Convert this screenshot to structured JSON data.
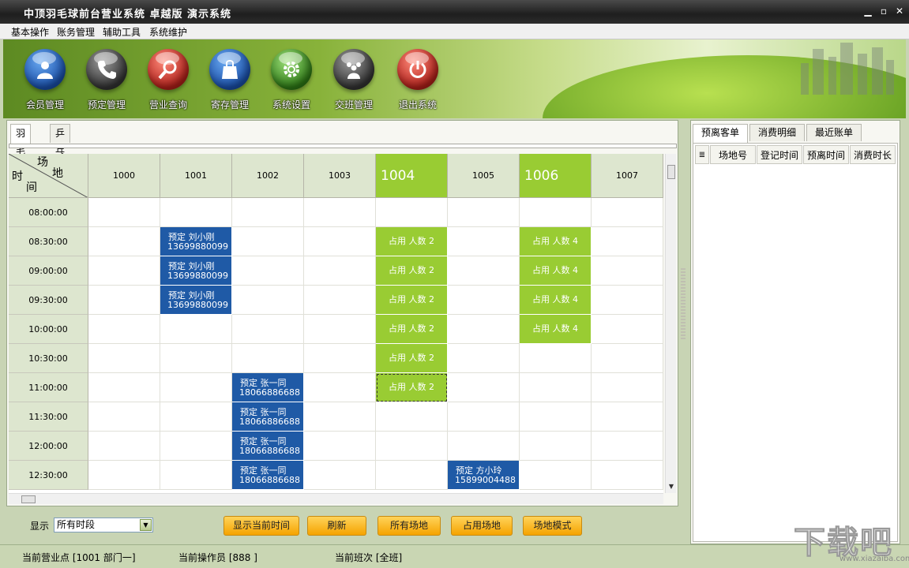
{
  "window": {
    "title": "中顶羽毛球前台营业系统 卓越版 演示系统"
  },
  "menu": [
    "基本操作",
    "账务管理",
    "辅助工具",
    "系统维护"
  ],
  "toolbar": [
    {
      "label": "会员管理",
      "icon": "member-icon",
      "color": "#2a6fd0"
    },
    {
      "label": "预定管理",
      "icon": "phone-icon",
      "color": "#4a4a4a"
    },
    {
      "label": "营业查询",
      "icon": "search-icon",
      "color": "#d8362a"
    },
    {
      "label": "寄存管理",
      "icon": "bag-icon",
      "color": "#2a6fd0"
    },
    {
      "label": "系统设置",
      "icon": "gear-icon",
      "color": "#4ea02a"
    },
    {
      "label": "交班管理",
      "icon": "group-icon",
      "color": "#4a4a4a"
    },
    {
      "label": "退出系统",
      "icon": "power-icon",
      "color": "#d8362a"
    }
  ],
  "tabs": [
    "羽毛球",
    "乒乓球"
  ],
  "grid": {
    "corner": {
      "top1": "场",
      "top2": "地",
      "bottom1": "时",
      "bottom2": "间"
    },
    "courts": [
      "1000",
      "1001",
      "1002",
      "1003",
      "1004",
      "1005",
      "1006",
      "1007"
    ],
    "highlight_courts": [
      "1004",
      "1006"
    ],
    "times": [
      "08:00:00",
      "08:30:00",
      "09:00:00",
      "09:30:00",
      "10:00:00",
      "10:30:00",
      "11:00:00",
      "11:30:00",
      "12:00:00",
      "12:30:00"
    ],
    "reservations": [
      {
        "court": "1001",
        "row": 1,
        "text": "预定  刘小刚",
        "phone": "13699880099"
      },
      {
        "court": "1001",
        "row": 2,
        "text": "预定  刘小刚",
        "phone": "13699880099"
      },
      {
        "court": "1001",
        "row": 3,
        "text": "预定  刘小刚",
        "phone": "13699880099"
      },
      {
        "court": "1002",
        "row": 6,
        "text": "预定  张一同",
        "phone": "18066886688"
      },
      {
        "court": "1002",
        "row": 7,
        "text": "预定  张一同",
        "phone": "18066886688"
      },
      {
        "court": "1002",
        "row": 8,
        "text": "预定  张一同",
        "phone": "18066886688"
      },
      {
        "court": "1002",
        "row": 9,
        "text": "预定  张一同",
        "phone": "18066886688"
      },
      {
        "court": "1005",
        "row": 9,
        "text": "预定  方小玲",
        "phone": "15899004488"
      }
    ],
    "occupied": [
      {
        "court": "1004",
        "row": 1,
        "text": "占用  人数 2"
      },
      {
        "court": "1004",
        "row": 2,
        "text": "占用  人数 2"
      },
      {
        "court": "1004",
        "row": 3,
        "text": "占用  人数 2"
      },
      {
        "court": "1004",
        "row": 4,
        "text": "占用  人数 2"
      },
      {
        "court": "1004",
        "row": 5,
        "text": "占用  人数 2"
      },
      {
        "court": "1004",
        "row": 6,
        "text": "占用  人数 2",
        "selected": true
      },
      {
        "court": "1006",
        "row": 1,
        "text": "占用  人数 4"
      },
      {
        "court": "1006",
        "row": 2,
        "text": "占用  人数 4"
      },
      {
        "court": "1006",
        "row": 3,
        "text": "占用  人数 4"
      },
      {
        "court": "1006",
        "row": 4,
        "text": "占用  人数 4"
      }
    ]
  },
  "bottom": {
    "show_label": "显示",
    "period_select": "所有时段",
    "buttons": [
      "显示当前时间",
      "刷新",
      "所有场地",
      "占用场地",
      "场地模式"
    ]
  },
  "right": {
    "tabs": [
      "预离客单",
      "消费明细",
      "最近账单"
    ],
    "columns": [
      "场地号",
      "登记时间",
      "预离时间",
      "消费时长"
    ]
  },
  "status": {
    "point": "当前营业点 [1001 部门一]",
    "operator": "当前操作员 [888 ]",
    "shift": "当前班次 [全班]"
  },
  "watermark": {
    "big": "下载吧",
    "small": "www.xiazaiba.com"
  },
  "colors": {
    "occupied": "#99cc33",
    "reserved": "#1f5aa6",
    "button": "#f5a300"
  }
}
